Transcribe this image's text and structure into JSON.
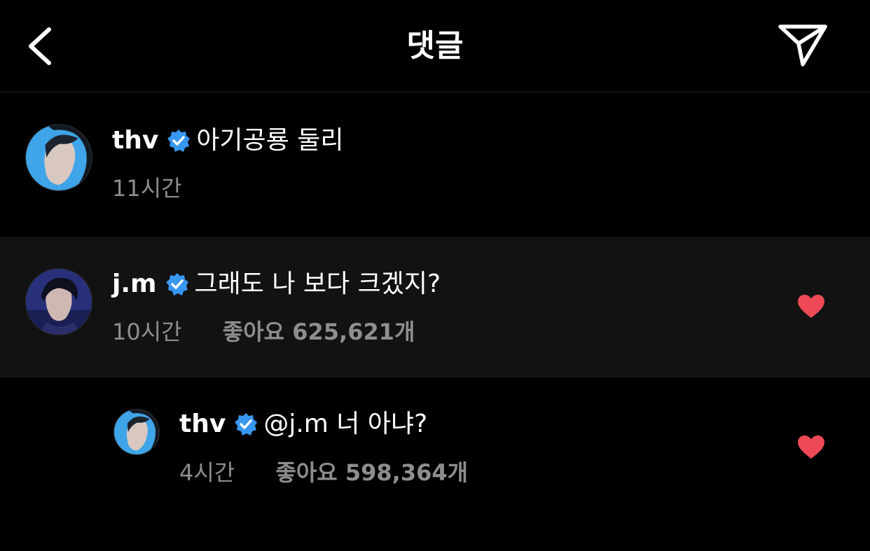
{
  "header": {
    "title": "댓글",
    "back_icon": "chevron-left-icon",
    "send_icon": "paper-plane-icon"
  },
  "comments": [
    {
      "username": "thv",
      "verified": true,
      "text": "아기공룡 둘리",
      "time": "11시간",
      "likes": "",
      "liked": false
    },
    {
      "username": "j.m",
      "verified": true,
      "text": "그래도 나 보다 크겠지?",
      "time": "10시간",
      "likes": "좋아요 625,621개",
      "liked": true
    },
    {
      "username": "thv",
      "verified": true,
      "text": "@j.m 너 아냐?",
      "time": "4시간",
      "likes": "좋아요 598,364개",
      "liked": true,
      "is_reply": true
    }
  ],
  "colors": {
    "background": "#000000",
    "highlight_row": "#121212",
    "verified_badge": "#3897f0",
    "heart": "#ed4956",
    "secondary_text": "#8e8e8e"
  }
}
